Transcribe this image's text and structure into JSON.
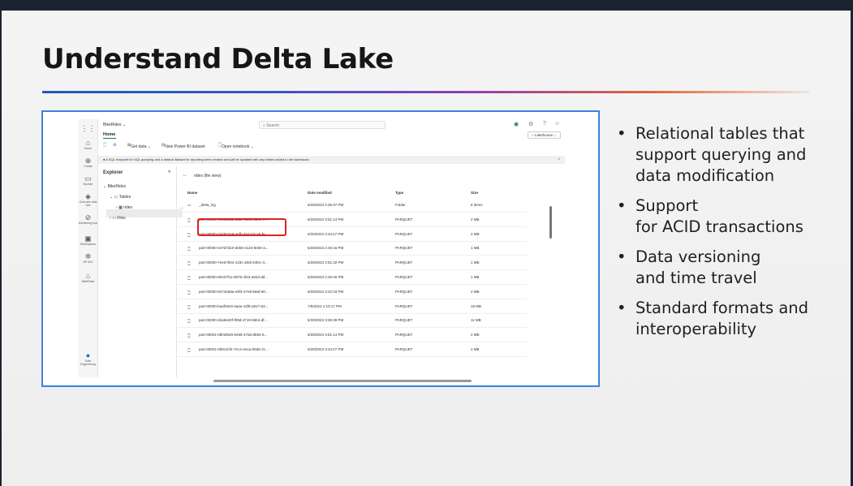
{
  "slide": {
    "title": "Understand Delta Lake",
    "bullets": [
      "Relational tables that\nsupport querying and\ndata modification",
      "Support\nfor ACID transactions",
      "Data versioning\nand time travel",
      "Standard formats and\ninteroperability"
    ],
    "bullet_symbol": "•"
  },
  "app": {
    "workspace_name": "BikeRides ⌄",
    "search_placeholder": "Search",
    "home_tab": "Home",
    "lakehouse_selector": "Lakehouse ⌄",
    "ribbon": {
      "get_data": "Get data ⌄",
      "new_dataset": "New Power BI dataset",
      "open_notebook": "Open notebook ⌄"
    },
    "info_message": "A SQL endpoint for SQL querying and a default dataset for reporting were created and will be updated with any tables added to the lakehouse.",
    "rail": [
      "Home",
      "Create",
      "Browse",
      "OneLake data hub",
      "Monitoring hub",
      "Workspaces",
      "DP-601",
      "BikeRides",
      "Data Engineering"
    ],
    "explorer": {
      "title": "Explorer",
      "tree": [
        "BikeRides",
        "Tables",
        "rides",
        "Files"
      ]
    },
    "breadcrumb": "rides (file view)",
    "columns": [
      "Name",
      "Date modified",
      "Type",
      "Size"
    ],
    "rows": [
      {
        "name": "_delta_log",
        "date": "6/28/2023 2:36:37 PM",
        "type": "Folder",
        "size": "8 items"
      },
      {
        "name": "part-00000-0e5630d2-a11c-4143-bbc3-e...",
        "date": "6/28/2023 3:51:14 PM",
        "type": "PARQUET",
        "size": "2 MB"
      },
      {
        "name": "part-00000-3a0915a9-4efb-4543-bcab-fe...",
        "date": "6/30/2023 3:34:27 PM",
        "type": "PARQUET",
        "size": "2 MB"
      },
      {
        "name": "part-00000-447d7d10-deb6-4123-8e50-a...",
        "date": "6/28/2023 2:45:16 PM",
        "type": "PARQUET",
        "size": "1 MB"
      },
      {
        "name": "part-00000-7ee67b04-133c-48cb-b92c-3...",
        "date": "6/28/2023 2:51:32 PM",
        "type": "PARQUET",
        "size": "1 MB"
      },
      {
        "name": "part-00000-80cb7f11-8978-4f23-a923-dd...",
        "date": "6/28/2023 2:36:40 PM",
        "type": "PARQUET",
        "size": "1 MB"
      },
      {
        "name": "part-00000-94740a8a-e5f3-47e8-b8af-60...",
        "date": "6/28/2023 3:42:33 PM",
        "type": "PARQUET",
        "size": "2 MB"
      },
      {
        "name": "part-00000-baaf29c9-4aae-44f8-a817-63...",
        "date": "7/5/2023 1:10:17 PM",
        "type": "PARQUET",
        "size": "19 MB"
      },
      {
        "name": "part-00000-d4a6640f-f09d-4719-b5b4-df...",
        "date": "6/30/2023 3:59:39 PM",
        "type": "PARQUET",
        "size": "11 MB"
      },
      {
        "name": "part-00001-05f4d948-6495-47da-9b84-6...",
        "date": "6/28/2023 3:51:14 PM",
        "type": "PARQUET",
        "size": "2 MB"
      },
      {
        "name": "part-00001-0b9c3cf4-7ec4-4e1a-b5d6-2c...",
        "date": "6/30/2023 3:34:27 PM",
        "type": "PARQUET",
        "size": "2 MB"
      }
    ],
    "colors": {
      "highlight": "#e02020",
      "frame": "#3b82e0",
      "accent": "#117865"
    }
  }
}
